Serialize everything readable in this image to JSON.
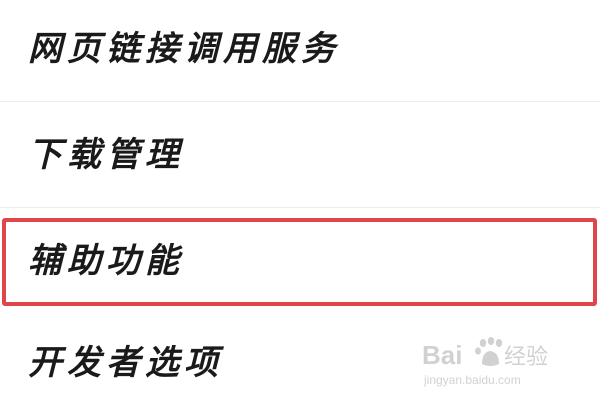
{
  "settings": {
    "items": [
      {
        "label": "网页链接调用服务"
      },
      {
        "label": "下载管理"
      },
      {
        "label": "辅助功能"
      },
      {
        "label": "开发者选项"
      }
    ]
  },
  "highlight": {
    "color": "#e0454a"
  },
  "watermark": {
    "brand": "Bai",
    "brand_suffix": "经验",
    "url": "jingyan.baidu.com"
  }
}
